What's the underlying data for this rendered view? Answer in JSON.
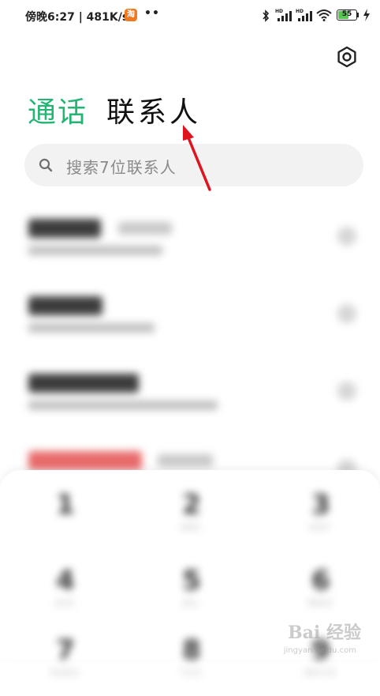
{
  "status_bar": {
    "time_speed": "傍晚6:27 | 481K/s",
    "app_icon_text": "淘",
    "dots": "••",
    "battery": "55"
  },
  "header": {
    "tab_calls": "通话",
    "tab_contacts": "联系人"
  },
  "search": {
    "placeholder": "搜索7位联系人"
  },
  "dialpad": {
    "keys": [
      {
        "num": "1",
        "letters": ""
      },
      {
        "num": "2",
        "letters": "ABC"
      },
      {
        "num": "3",
        "letters": "DEF"
      },
      {
        "num": "4",
        "letters": "GHI"
      },
      {
        "num": "5",
        "letters": "JKL"
      },
      {
        "num": "6",
        "letters": "MNO"
      },
      {
        "num": "7",
        "letters": "PQRS"
      },
      {
        "num": "8",
        "letters": "TUV"
      },
      {
        "num": "9",
        "letters": "WXYZ"
      }
    ]
  },
  "watermark": {
    "text": "Bai 经验",
    "sub": "jingyan.baidu.com"
  },
  "colors": {
    "accent_green": "#22b573",
    "annotation_red": "#e0141e"
  }
}
